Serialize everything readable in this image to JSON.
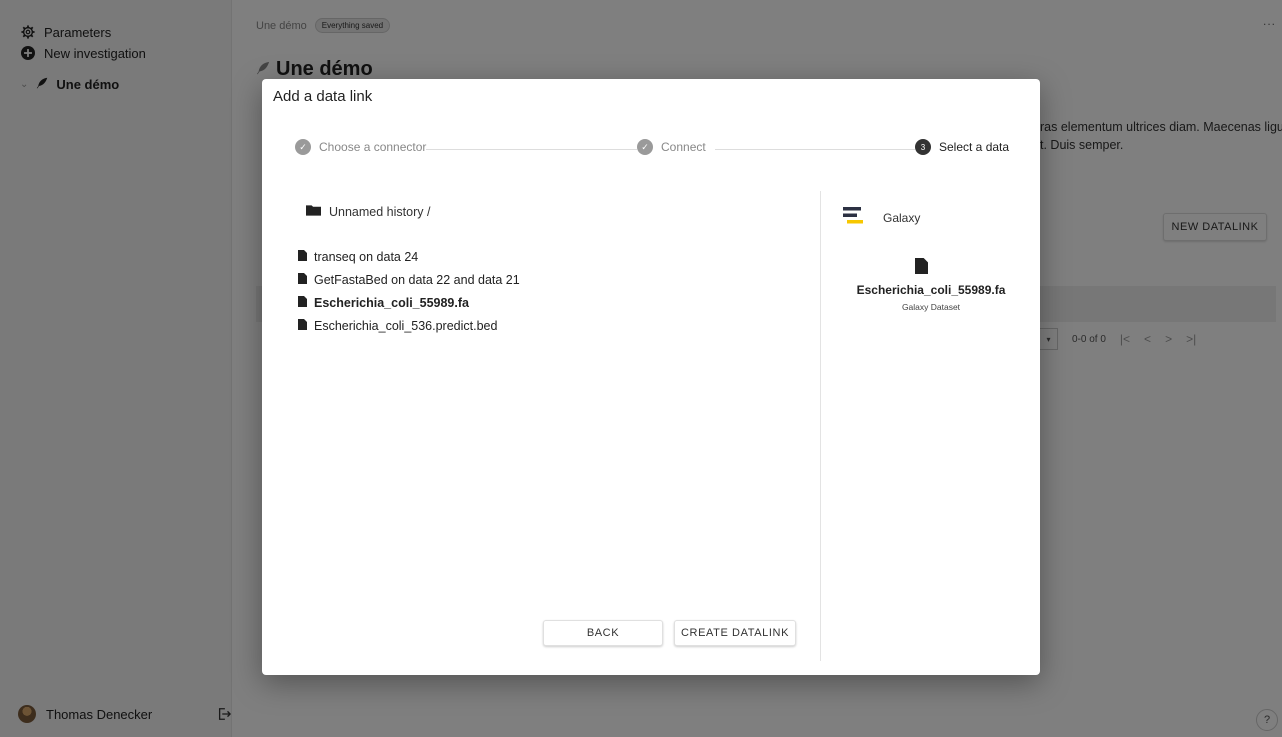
{
  "sidebar": {
    "parameters_label": "Parameters",
    "new_investigation_label": "New investigation",
    "tree_item_label": "Une démo",
    "user_name": "Thomas Denecker"
  },
  "header": {
    "breadcrumb": "Une démo",
    "save_status": "Everything saved",
    "more_label": "..."
  },
  "page": {
    "title": "Une démo",
    "description_line1": "ras elementum ultrices diam. Maecenas ligula",
    "description_line2": "t. Duis semper.",
    "new_datalink_label": "NEW DATALINK",
    "pagination_text": "0-0 of 0",
    "help_label": "?"
  },
  "modal": {
    "title": "Add a data link",
    "steps": [
      {
        "label": "Choose a connector",
        "state": "done",
        "marker": "✓"
      },
      {
        "label": "Connect",
        "state": "done",
        "marker": "✓"
      },
      {
        "label": "Select a data",
        "state": "active",
        "marker": "3"
      }
    ],
    "folder_label": "Unnamed history /",
    "files": [
      {
        "name": "transeq on data 24",
        "selected": false
      },
      {
        "name": "GetFastaBed on data 22 and data 21",
        "selected": false
      },
      {
        "name": "Escherichia_coli_55989.fa",
        "selected": true
      },
      {
        "name": "Escherichia_coli_536.predict.bed",
        "selected": false
      }
    ],
    "back_label": "BACK",
    "create_label": "CREATE DATALINK",
    "connector_name": "Galaxy",
    "selected_file_name": "Escherichia_coli_55989.fa",
    "selected_file_type": "Galaxy Dataset"
  },
  "colors": {
    "overlay": "#00000080",
    "step_done": "#9a9a9a",
    "step_active": "#333333",
    "galaxy_dark": "#2c3143",
    "galaxy_yellow": "#f7c700"
  },
  "icons": {
    "parameters": "gear-icon",
    "new_investigation": "plus-circle-icon",
    "tree_expand": "chevron-down-icon",
    "investigation": "feather-icon",
    "logout": "logout-icon",
    "folder": "folder-icon",
    "file": "file-icon",
    "connector": "galaxy-logo-icon"
  }
}
